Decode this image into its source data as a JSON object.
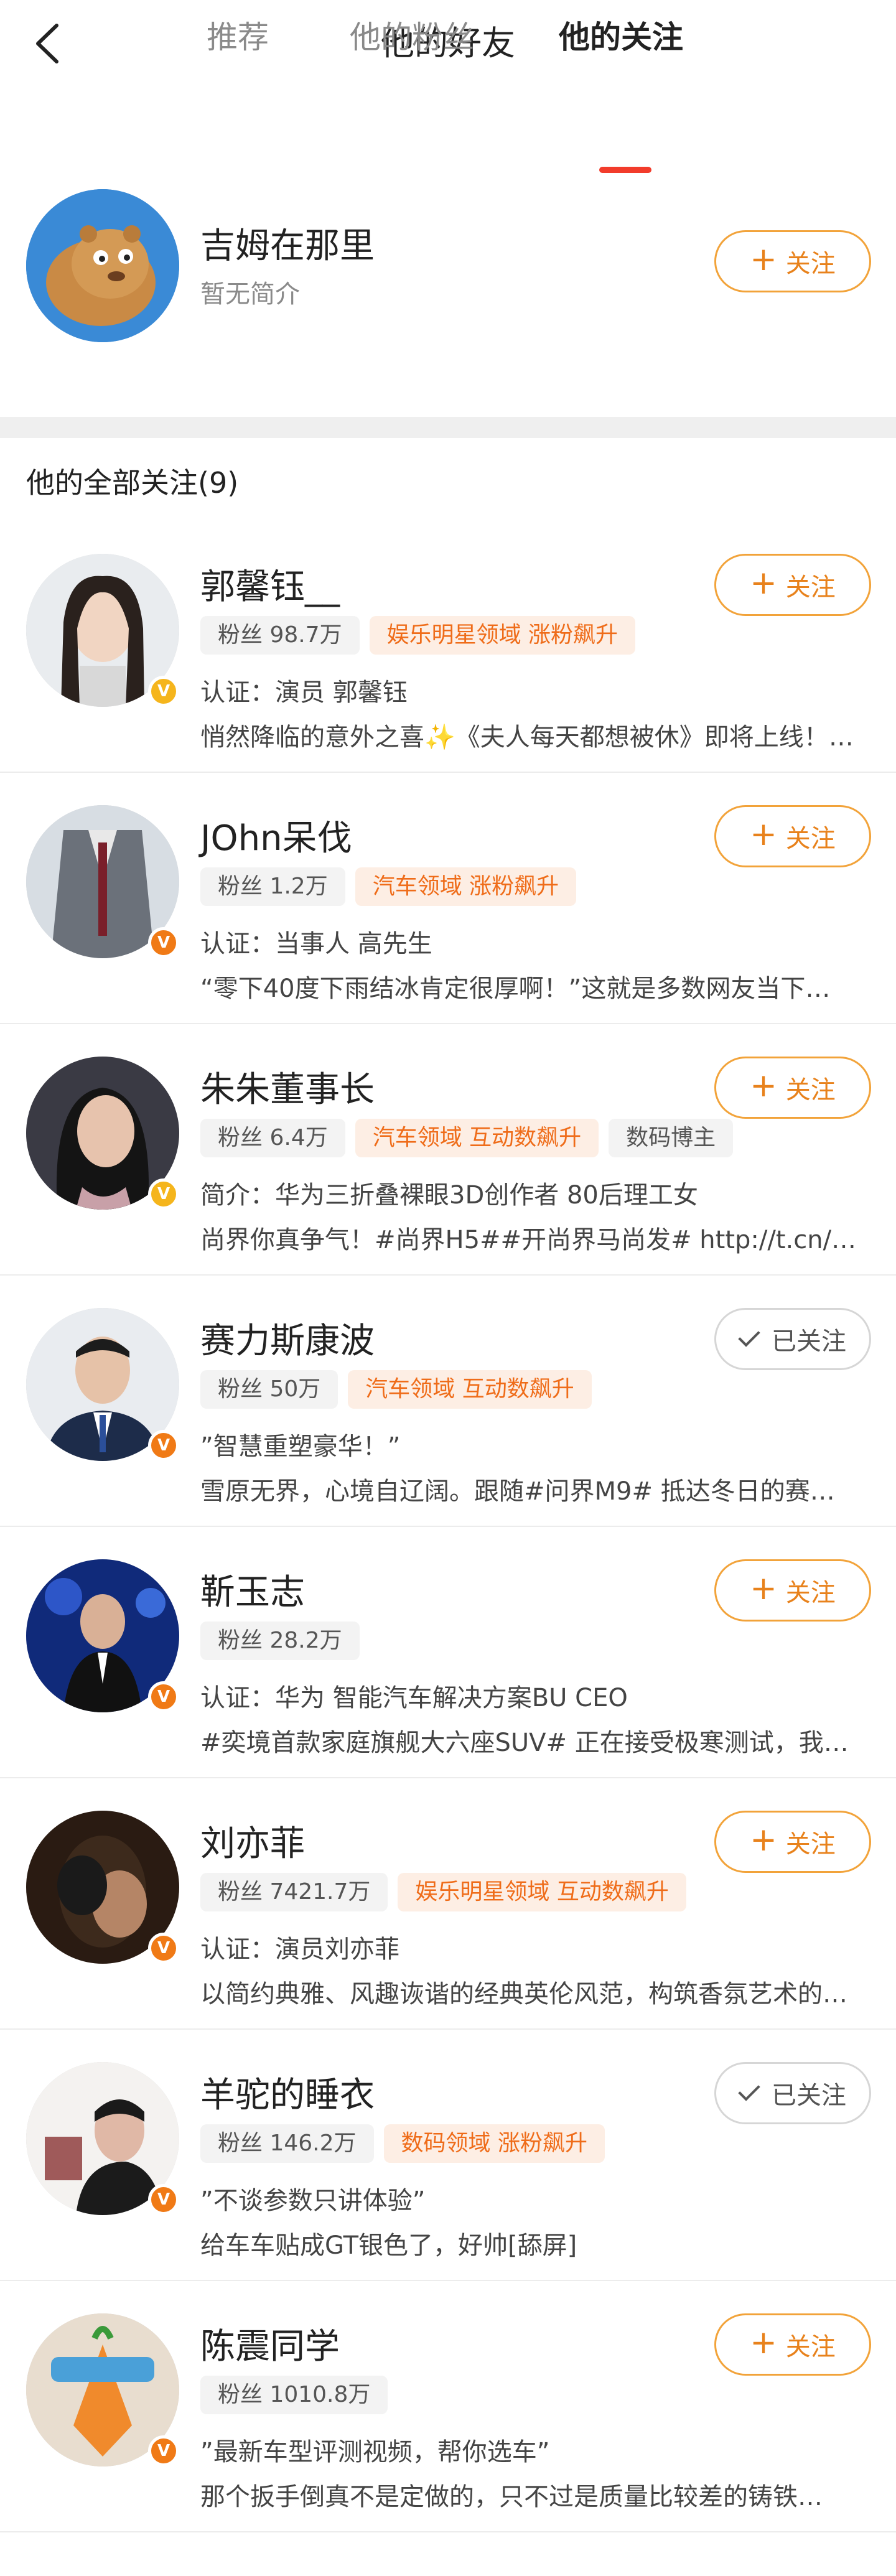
{
  "header": {
    "title": "他的好友",
    "back_icon": "chevron-left-icon"
  },
  "tabs": [
    {
      "label": "推荐",
      "active": false
    },
    {
      "label": "他的粉丝",
      "active": false
    },
    {
      "label": "他的关注",
      "active": true
    }
  ],
  "colors": {
    "accent": "#f23c2b",
    "follow_orange": "#e8821c",
    "tag_hot": "#ef6c19"
  },
  "top_user": {
    "name": "吉姆在那里",
    "bio": "暂无简介",
    "button_label": "关注",
    "button_icon": "plus-icon"
  },
  "section_title": "他的全部关注(9)",
  "follow_label": "关注",
  "followed_label": "已关注",
  "users": [
    {
      "name": "郭馨钰__",
      "fans": "粉丝 98.7万",
      "tags": [
        "娱乐明星领域 涨粉飙升"
      ],
      "line1": "认证：演员 郭馨钰",
      "line2": "悄然降临的意外之喜✨《夫人每天都想被休》即将上线！我…",
      "followed": false,
      "badge": "gold"
    },
    {
      "name": "JOhn呆伐",
      "fans": "粉丝 1.2万",
      "tags": [
        "汽车领域 涨粉飙升"
      ],
      "line1": "认证：当事人 高先生",
      "line2": "“零下40度下雨结冰肯定很厚啊！”这就是多数网友当下…",
      "followed": false,
      "badge": "orange"
    },
    {
      "name": "朱朱董事长",
      "fans": "粉丝 6.4万",
      "tags": [
        "汽车领域 互动数飙升",
        "数码博主"
      ],
      "line1": "简介：华为三折叠裸眼3D创作者 80后理工女",
      "line2": "尚界你真争气！#尚界H5##开尚界马尚发# http://t.cn/…",
      "followed": false,
      "badge": "gold"
    },
    {
      "name": "赛力斯康波",
      "fans": "粉丝 50万",
      "tags": [
        "汽车领域 互动数飙升"
      ],
      "line1": "”智慧重塑豪华！”",
      "line2": "雪原无界，心境自辽阔。跟随#问界M9# 抵达冬日的赛…",
      "followed": true,
      "badge": "orange"
    },
    {
      "name": "靳玉志",
      "fans": "粉丝 28.2万",
      "tags": [],
      "line1": "认证：华为 智能汽车解决方案BU CEO",
      "line2": "#奕境首款家庭旗舰大六座SUV# 正在接受极寒测试，我…",
      "followed": false,
      "badge": "orange"
    },
    {
      "name": "刘亦菲",
      "fans": "粉丝 7421.7万",
      "tags": [
        "娱乐明星领域 互动数飙升"
      ],
      "line1": "认证：演员刘亦菲",
      "line2": "以简约典雅、风趣诙谐的经典英伦风范，构筑香氛艺术的…",
      "followed": false,
      "badge": "orange"
    },
    {
      "name": "羊驼的睡衣",
      "fans": "粉丝 146.2万",
      "tags": [
        "数码领域 涨粉飙升"
      ],
      "line1": "”不谈参数只讲体验”",
      "line2": "给车车贴成GT银色了，好帅[舔屏]",
      "followed": true,
      "badge": "orange"
    },
    {
      "name": "陈震同学",
      "fans": "粉丝 1010.8万",
      "tags": [],
      "line1": "”最新车型评测视频，帮你选车”",
      "line2": "那个扳手倒真不是定做的，只不过是质量比较差的铸铁…",
      "followed": false,
      "badge": "orange"
    }
  ]
}
